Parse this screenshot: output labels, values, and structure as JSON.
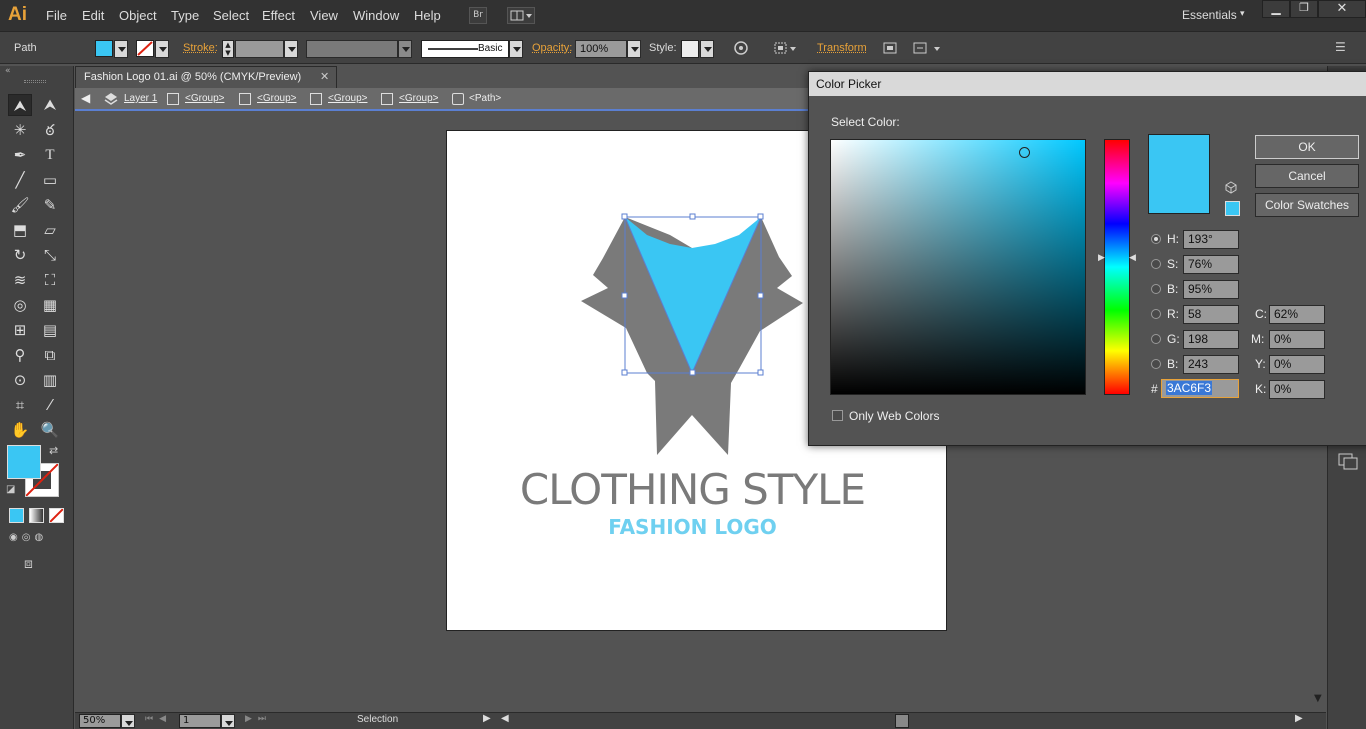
{
  "app": {
    "logo": "Ai",
    "menu": [
      "File",
      "Edit",
      "Object",
      "Type",
      "Select",
      "Effect",
      "View",
      "Window",
      "Help"
    ],
    "workspace": "Essentials",
    "bridge_label": "Br"
  },
  "controlbar": {
    "selection_type": "Path",
    "fill_color": "#3ac6f3",
    "stroke_label": "Stroke:",
    "brush_label": "Basic",
    "opacity_label": "Opacity:",
    "opacity_value": "100%",
    "style_label": "Style:",
    "transform_label": "Transform"
  },
  "document": {
    "tab_title": "Fashion Logo 01.ai @ 50% (CMYK/Preview)",
    "breadcrumb": [
      "Layer 1",
      "<Group>",
      "<Group>",
      "<Group>",
      "<Group>",
      "<Path>"
    ]
  },
  "artwork": {
    "title": "CLOTHING STYLE",
    "subtitle": "FASHION LOGO",
    "gray": "#7a7a7a",
    "blue": "#3ac6f3",
    "subtitle_color": "#6fd0f0"
  },
  "status": {
    "zoom": "50%",
    "page": "1",
    "tool": "Selection"
  },
  "color_picker": {
    "title": "Color Picker",
    "select_label": "Select Color:",
    "ok": "OK",
    "cancel": "Cancel",
    "swatches": "Color Swatches",
    "only_web": "Only Web Colors",
    "hsb": [
      {
        "label": "H:",
        "value": "193°"
      },
      {
        "label": "S:",
        "value": "76%"
      },
      {
        "label": "B:",
        "value": "95%"
      }
    ],
    "rgb": [
      {
        "label": "R:",
        "value": "58"
      },
      {
        "label": "G:",
        "value": "198"
      },
      {
        "label": "B:",
        "value": "243"
      }
    ],
    "cmyk": [
      {
        "label": "C:",
        "value": "62%"
      },
      {
        "label": "M:",
        "value": "0%"
      },
      {
        "label": "Y:",
        "value": "0%"
      },
      {
        "label": "K:",
        "value": "0%"
      }
    ],
    "hex_label": "#",
    "hex": "3AC6F3",
    "hue_color": "#00c8ff"
  }
}
